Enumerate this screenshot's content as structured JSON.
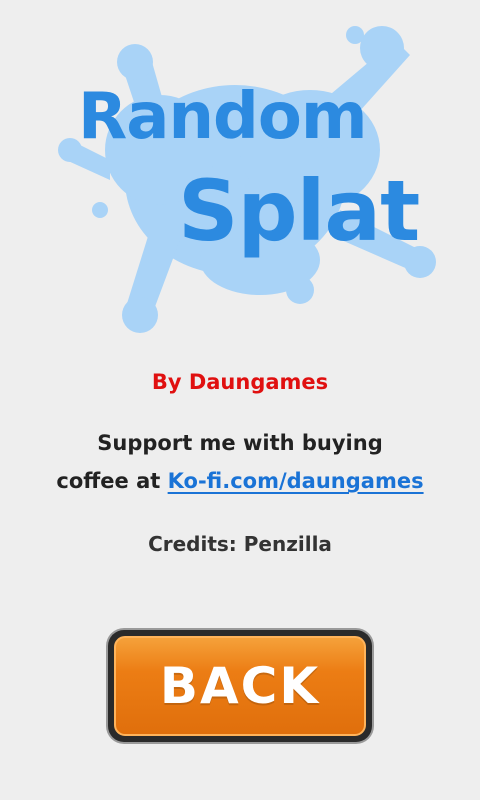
{
  "logo": {
    "line1": "Random",
    "line2": "Splat"
  },
  "author": "By Daungames",
  "support": {
    "line1": "Support me with buying",
    "line2_prefix": "coffee at ",
    "link": "Ko-fi.com/daungames"
  },
  "credits": "Credits: Penzilla",
  "back_button": {
    "label": "BACK"
  },
  "colors": {
    "background": "#eeeeee",
    "logo_text": "#2c8ae0",
    "splat": "#a9d3f7",
    "author": "#e01010",
    "link": "#1a73d6",
    "button": "#ec7d14"
  }
}
